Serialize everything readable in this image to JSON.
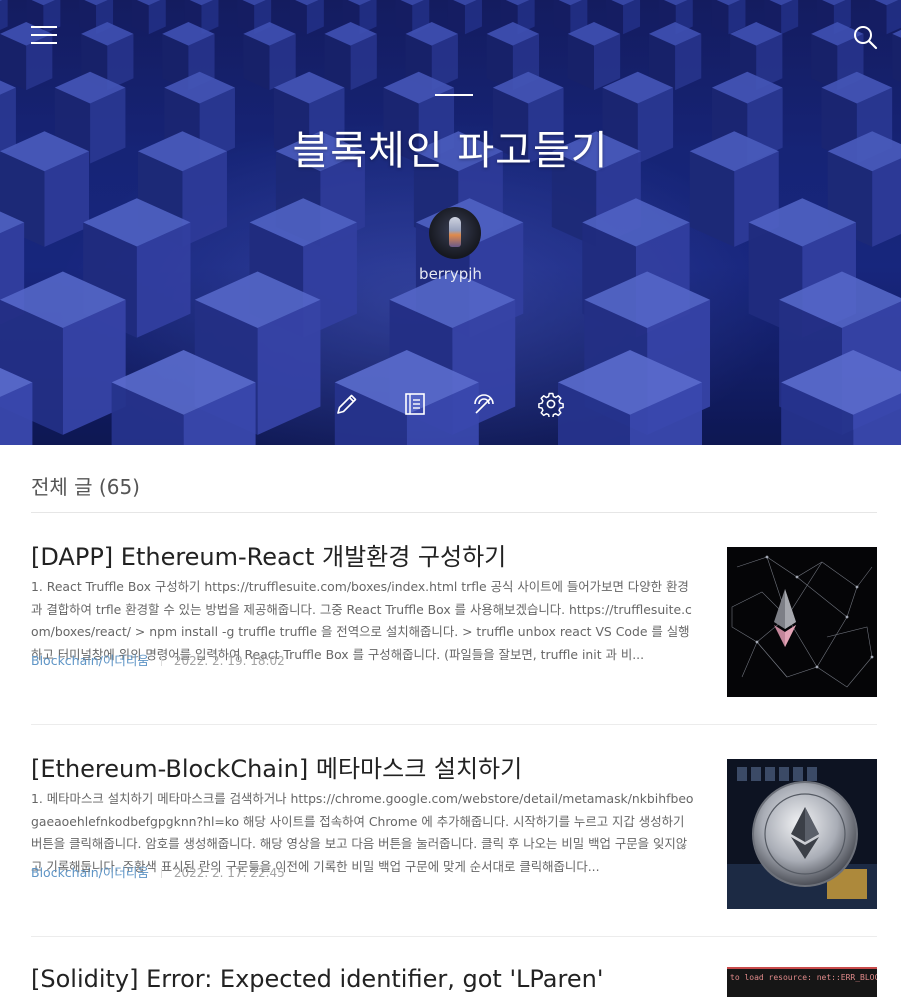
{
  "blog": {
    "title": "블록체인 파고들기",
    "author": "berrypjh"
  },
  "icons": {
    "menu": "menu-icon",
    "search": "search-icon",
    "tools": [
      "pencil-icon",
      "notebook-icon",
      "feed-icon",
      "gear-icon"
    ]
  },
  "section": {
    "heading": "전체 글 (65)"
  },
  "posts": [
    {
      "title": "[DAPP] Ethereum-React 개발환경 구성하기",
      "excerpt": "1. React Truffle Box 구성하기 https://trufflesuite.com/boxes/index.html trfle 공식 사이트에 들어가보면 다양한 환경과 결합하여 trfle 환경할 수 있는 방법을 제공해줍니다. 그중 React Truffle Box 를 사용해보겠습니다. https://trufflesuite.com/boxes/react/ > npm install -g truffle truffle 을 전역으로 설치해줍니다. > truffle unbox react VS Code 를 실행하고 터미널창에 위의 명령어를 입력하여 React Truffle Box 를 구성해줍니다. (파일들을 잘보면, truffle init 과 비...",
      "category": "Blockchain/이더리움",
      "date": "2022. 2. 19. 18:02"
    },
    {
      "title": "[Ethereum-BlockChain] 메타마스크 설치하기",
      "excerpt": "1. 메타마스크 설치하기 메타마스크를 검색하거나 https://chrome.google.com/webstore/detail/metamask/nkbihfbeogaeaoehlefnkodbefgpgknn?hl=ko 해당 사이트를 접속하여 Chrome 에 추가해줍니다. 시작하기를 누르고 지갑 생성하기 버튼을 클릭해줍니다. 암호를 생성해줍니다. 해당 영상을 보고 다음 버튼을 눌러줍니다. 클릭 후 나오는 비밀 백업 구문을 잊지않고 기록해둡니다. 주황색 표시된 란의 구문들을 이전에 기록한 비밀 백업 구문에 맞게 순서대로 클릭해줍니다...",
      "category": "Blockchain/이더리움",
      "date": "2022. 2. 17. 22:45"
    },
    {
      "title": "[Solidity] Error: Expected identifier, got 'LParen'",
      "thumb_text": "to load resource: net::ERR_BLOCKED"
    }
  ],
  "colors": {
    "hero_bg": "#1a2a86",
    "category_link": "#5f95c6",
    "date_text": "#a3a3a3"
  }
}
